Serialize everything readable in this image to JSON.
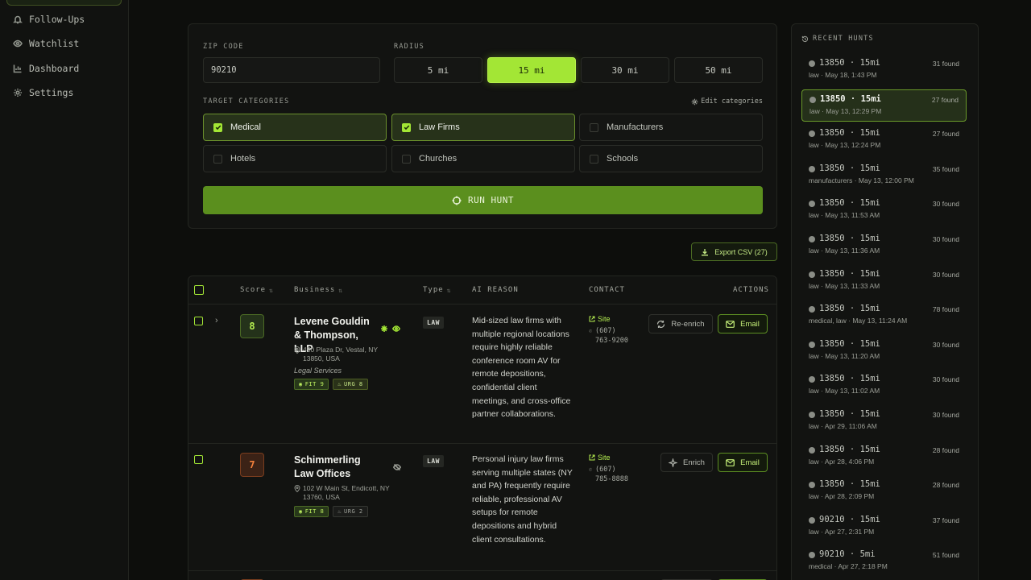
{
  "sidebar": {
    "items": [
      {
        "label": "Follow-Ups",
        "icon": "bell-icon"
      },
      {
        "label": "Watchlist",
        "icon": "eye-icon"
      },
      {
        "label": "Dashboard",
        "icon": "bar-chart-icon"
      },
      {
        "label": "Settings",
        "icon": "gear-icon"
      }
    ]
  },
  "form": {
    "zip_label": "ZIP CODE",
    "zip_value": "90210",
    "radius_label": "RADIUS",
    "radius_options": [
      "5 mi",
      "15 mi",
      "30 mi",
      "50 mi"
    ],
    "radius_selected": "15 mi",
    "categories_label": "TARGET CATEGORIES",
    "edit_categories": "Edit categories",
    "categories": [
      {
        "label": "Medical",
        "checked": true
      },
      {
        "label": "Law Firms",
        "checked": true
      },
      {
        "label": "Manufacturers",
        "checked": false
      },
      {
        "label": "Hotels",
        "checked": false
      },
      {
        "label": "Churches",
        "checked": false
      },
      {
        "label": "Schools",
        "checked": false
      }
    ],
    "run_label": "RUN HUNT"
  },
  "export_label": "Export CSV (27)",
  "table": {
    "headers": {
      "score": "Score",
      "business": "Business",
      "type": "Type",
      "reason": "AI REASON",
      "contact": "CONTACT",
      "actions": "ACTIONS"
    },
    "rows": [
      {
        "score": "8",
        "name": "Levene Gouldin & Thompson, LLP",
        "address": "450 Plaza Dr, Vestal, NY 13850, USA",
        "industry": "Legal Services",
        "fit": "FIT 9",
        "urg": "URG 8",
        "type": "LAW",
        "reason": "Mid-sized law firms with multiple regional locations require highly reliable conference room AV for remote depositions, confidential client meetings, and cross-office partner collaborations.",
        "site": "Site",
        "phone": "(607) 763-9200",
        "action1": "Re-enrich",
        "action2": "Email"
      },
      {
        "score": "7",
        "name": "Schimmerling Law Offices",
        "address": "102 W Main St, Endicott, NY 13760, USA",
        "industry": "",
        "fit": "FIT 8",
        "urg": "URG 2",
        "type": "LAW",
        "reason": "Personal injury law firms serving multiple states (NY and PA) frequently require reliable, professional AV setups for remote depositions and hybrid client consultations.",
        "site": "Site",
        "phone": "(607) 785-8888",
        "action1": "Enrich",
        "action2": "Email"
      }
    ]
  },
  "recent": {
    "title": "RECENT HUNTS",
    "items": [
      {
        "zip": "13850 · 15mi",
        "found": "31 found",
        "detail": "law · May 18, 1:43 PM"
      },
      {
        "zip": "13850 · 15mi",
        "found": "27 found",
        "detail": "law · May 13, 12:29 PM"
      },
      {
        "zip": "13850 · 15mi",
        "found": "27 found",
        "detail": "law · May 13, 12:24 PM"
      },
      {
        "zip": "13850 · 15mi",
        "found": "35 found",
        "detail": "manufacturers · May 13, 12:00 PM"
      },
      {
        "zip": "13850 · 15mi",
        "found": "30 found",
        "detail": "law · May 13, 11:53 AM"
      },
      {
        "zip": "13850 · 15mi",
        "found": "30 found",
        "detail": "law · May 13, 11:36 AM"
      },
      {
        "zip": "13850 · 15mi",
        "found": "30 found",
        "detail": "law · May 13, 11:33 AM"
      },
      {
        "zip": "13850 · 15mi",
        "found": "78 found",
        "detail": "medical, law · May 13, 11:24 AM"
      },
      {
        "zip": "13850 · 15mi",
        "found": "30 found",
        "detail": "law · May 13, 11:20 AM"
      },
      {
        "zip": "13850 · 15mi",
        "found": "30 found",
        "detail": "law · May 13, 11:02 AM"
      },
      {
        "zip": "13850 · 15mi",
        "found": "30 found",
        "detail": "law · Apr 29, 11:06 AM"
      },
      {
        "zip": "13850 · 15mi",
        "found": "28 found",
        "detail": "law · Apr 28, 4:06 PM"
      },
      {
        "zip": "13850 · 15mi",
        "found": "28 found",
        "detail": "law · Apr 28, 2:09 PM"
      },
      {
        "zip": "90210 · 15mi",
        "found": "37 found",
        "detail": "law · Apr 27, 2:31 PM"
      },
      {
        "zip": "90210 · 5mi",
        "found": "51 found",
        "detail": "medical · Apr 27, 2:18 PM"
      }
    ],
    "selected_index": 1
  },
  "colors": {
    "accent": "#a3e635",
    "run_button": "#5b8f1e",
    "score_high": "#b5ef50",
    "score_mid": "#f3803c",
    "background": "#0d0e0c"
  }
}
